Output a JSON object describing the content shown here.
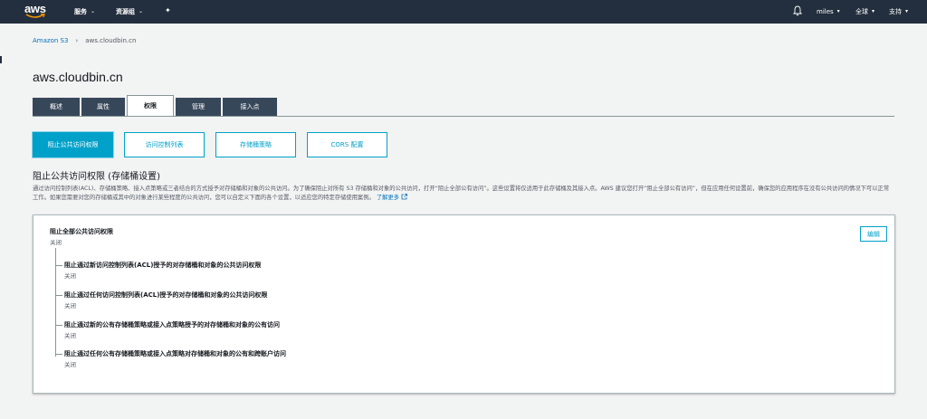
{
  "topnav": {
    "logo": "aws",
    "services": "服务",
    "resource_groups": "资源组",
    "user": "miles",
    "region": "全球",
    "support": "支持"
  },
  "breadcrumb": {
    "root": "Amazon S3",
    "separator": "›",
    "current": "aws.cloudbin.cn"
  },
  "page_title": "aws.cloudbin.cn",
  "tabs": [
    {
      "label": "概述"
    },
    {
      "label": "属性"
    },
    {
      "label": "权限"
    },
    {
      "label": "管理"
    },
    {
      "label": "接入点"
    }
  ],
  "sub_tabs": [
    {
      "label": "阻止公共访问权限"
    },
    {
      "label": "访问控制列表"
    },
    {
      "label": "存储桶策略"
    },
    {
      "label": "CORS 配置"
    }
  ],
  "section": {
    "heading": "阻止公共访问权限 (存储桶设置)",
    "description": "通过访问控制列表(ACL)、存储桶策略、接入点策略或三者结合的方式授予对存储桶和对象的公共访问。为了确保阻止对所有 S3 存储桶和对象的公共访问，打开“阻止全部公有访问”。这些设置将仅适用于此存储桶及其接入点。AWS 建议您打开“阻止全部公有访问”，但在应用任何设置前，确保您的应用程序在没有公共访问的情况下可以正常工作。如果您需要对您的存储桶或其中的对象进行某些程度的公共访问，您可以自定义下面的各个设置，以适应您的特定存储使用案例。",
    "learn_more": "了解更多"
  },
  "card": {
    "edit_label": "编辑",
    "main_label": "阻止全部公共访问权限",
    "main_value": "关闭",
    "items": [
      {
        "label": "阻止通过新访问控制列表(ACL)授予的对存储桶和对象的公共访问权限",
        "value": "关闭"
      },
      {
        "label": "阻止通过任何访问控制列表(ACL)授予的对存储桶和对象的公共访问权限",
        "value": "关闭"
      },
      {
        "label": "阻止通过新的公有存储桶策略或接入点策略授予的对存储桶和对象的公有访问",
        "value": "关闭"
      },
      {
        "label": "阻止通过任何公有存储桶策略或接入点策略对存储桶和对象的公有和跨账户访问",
        "value": "关闭"
      }
    ]
  },
  "icons": {
    "bell": "bell-icon",
    "pin": "pin-icon",
    "external": "external-link-icon"
  },
  "colors": {
    "nav_bg": "#232f3e",
    "tab_bg": "#37475a",
    "accent": "#00a1c9",
    "link": "#0073bb"
  }
}
